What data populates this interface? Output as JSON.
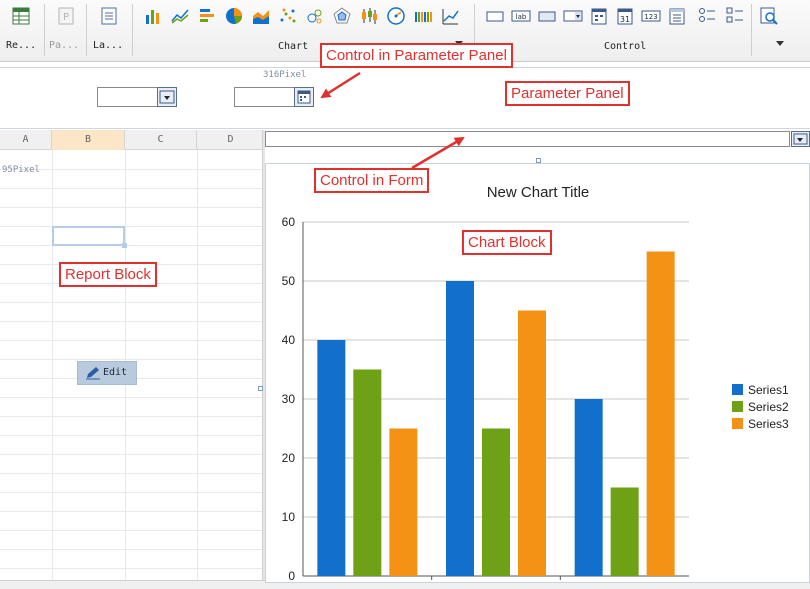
{
  "toolbar": {
    "left_buttons": [
      {
        "label": "Re...",
        "icon": "report-block-icon",
        "dim": false
      },
      {
        "label": "Pa...",
        "icon": "parameter-panel-icon",
        "dim": true
      },
      {
        "label": "La...",
        "icon": "layout-icon",
        "dim": false
      }
    ],
    "chart_group_label": "Chart",
    "chart_icons": [
      "bar-chart-icon",
      "line-chart-icon",
      "horizontal-bar-icon",
      "pie-chart-icon",
      "area-chart-icon",
      "scatter-chart-icon",
      "bubble-chart-icon",
      "radar-chart-icon",
      "candlestick-chart-icon",
      "gauge-chart-icon",
      "stacked-bar-icon",
      "combination-chart-icon"
    ],
    "control_group_label": "Control",
    "control_icons": [
      "textbox-icon",
      "label-icon",
      "button-icon",
      "combobox-icon",
      "datetime-icon",
      "date-icon",
      "number-icon",
      "tree-icon",
      "radio-group-icon",
      "checkbox-group-icon",
      "query-icon"
    ],
    "control_icon_texts": {
      "label": "lab",
      "date": "31",
      "number": "123"
    }
  },
  "parameter_panel": {
    "pixel_label": "316Pixel"
  },
  "sheet": {
    "columns": [
      "A",
      "B",
      "C",
      "D"
    ],
    "selected_column": "B",
    "pixel_label": "95Pixel",
    "edit_label": "Edit"
  },
  "chart_data": {
    "type": "bar",
    "title": "New Chart Title",
    "categories": [
      "",
      "",
      ""
    ],
    "series": [
      {
        "name": "Series1",
        "color": "#1270cc",
        "values": [
          40,
          50,
          30
        ]
      },
      {
        "name": "Series2",
        "color": "#6ea115",
        "values": [
          35,
          25,
          15
        ]
      },
      {
        "name": "Series3",
        "color": "#f39214",
        "values": [
          25,
          45,
          55
        ]
      }
    ],
    "ylim": [
      0,
      60
    ],
    "yticks": [
      0,
      10,
      20,
      30,
      40,
      50,
      60
    ],
    "grid": true,
    "legend": "right"
  },
  "callouts": {
    "control_in_parameter_panel": "Control in Parameter Panel",
    "parameter_panel": "Parameter Panel",
    "control_in_form": "Control in Form",
    "chart_block": "Chart Block",
    "report_block": "Report Block"
  },
  "colors": {
    "callout": "#e0312f",
    "selected_column_header": "#fbe6c8",
    "edit_button": "#b9c9de"
  }
}
